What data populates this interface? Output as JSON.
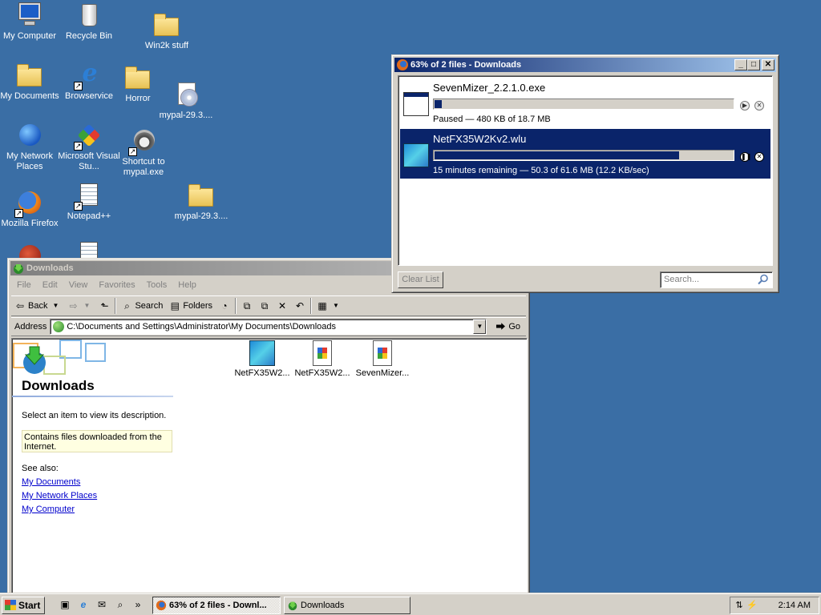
{
  "desktop": {
    "icons": [
      {
        "label": "My Computer"
      },
      {
        "label": "Recycle Bin"
      },
      {
        "label": "Win2k stuff"
      },
      {
        "label": "My Documents"
      },
      {
        "label": "Browservice"
      },
      {
        "label": "Horror"
      },
      {
        "label": "mypal-29.3...."
      },
      {
        "label": "My Network Places"
      },
      {
        "label": "Microsoft Visual Stu..."
      },
      {
        "label": "Shortcut to mypal.exe"
      },
      {
        "label": "Mozilla Firefox"
      },
      {
        "label": "Notepad++"
      },
      {
        "label": "mypal-29.3...."
      }
    ]
  },
  "download_manager": {
    "title": "63% of 2 files - Downloads",
    "items": [
      {
        "name": "SevenMizer_2.2.1.0.exe",
        "status": "Paused — 480 KB of 18.7 MB",
        "progress": 0.03,
        "state": "paused",
        "icon": "exe-icon"
      },
      {
        "name": "NetFX35W2Kv2.wlu",
        "status": "15 minutes remaining — 50.3 of 61.6 MB (12.2 KB/sec)",
        "progress": 0.82,
        "state": "downloading",
        "icon": "wlu-icon"
      }
    ],
    "clear_list_label": "Clear List",
    "search_placeholder": "Search..."
  },
  "explorer": {
    "title": "Downloads",
    "menu": [
      "File",
      "Edit",
      "View",
      "Favorites",
      "Tools",
      "Help"
    ],
    "toolbar": {
      "back": "Back",
      "search": "Search",
      "folders": "Folders"
    },
    "address_label": "Address",
    "address_value": "C:\\Documents and Settings\\Administrator\\My Documents\\Downloads",
    "go_label": "Go",
    "webview": {
      "title": "Downloads",
      "description": "Select an item to view its description.",
      "note": "Contains files downloaded from the Internet.",
      "see_also": "See also:",
      "links": [
        "My Documents",
        "My Network Places",
        "My Computer"
      ]
    },
    "files": [
      {
        "label": "NetFX35W2...",
        "icon": "wlu-file-icon"
      },
      {
        "label": "NetFX35W2...",
        "icon": "installer-file-icon"
      },
      {
        "label": "SevenMizer...",
        "icon": "installer-file-icon"
      }
    ]
  },
  "taskbar": {
    "start_label": "Start",
    "tasks": [
      {
        "label": "63% of 2 files - Downl...",
        "active": true
      },
      {
        "label": "Downloads",
        "active": false
      }
    ],
    "clock": "2:14 AM"
  }
}
